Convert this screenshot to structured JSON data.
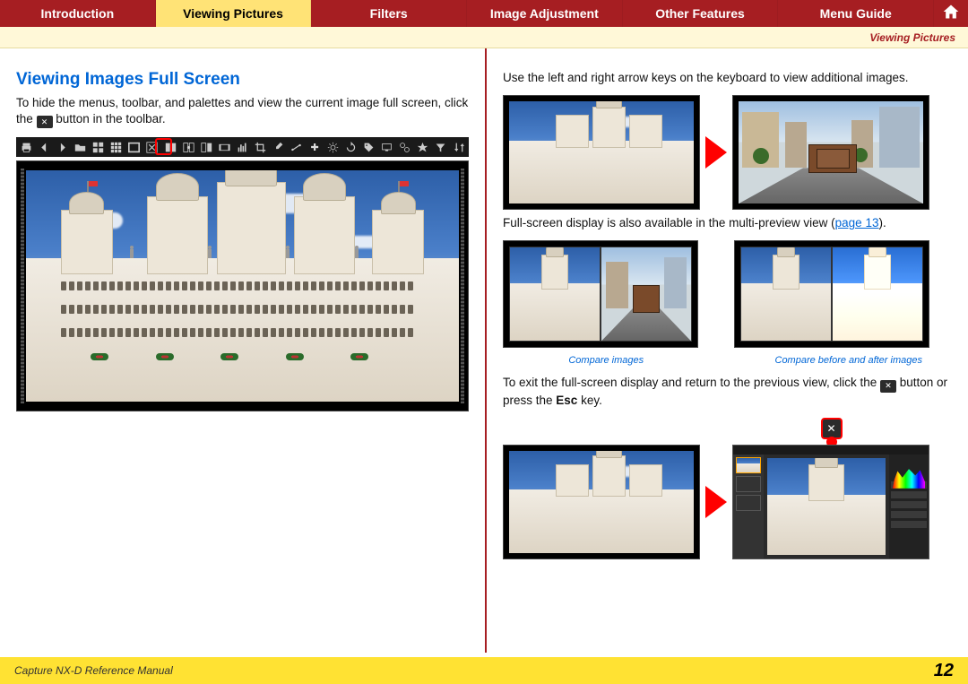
{
  "nav": {
    "tabs": [
      {
        "label": "Introduction"
      },
      {
        "label": "Viewing Pictures"
      },
      {
        "label": "Filters"
      },
      {
        "label": "Image Adjustment"
      },
      {
        "label": "Other Features"
      },
      {
        "label": "Menu Guide"
      }
    ],
    "active_index": 1,
    "home_icon": "home-icon"
  },
  "subbar_label": "Viewing Pictures",
  "left": {
    "title": "Viewing Images Full Screen",
    "para1_a": "To hide the menus, toolbar, and palettes and view the current image full screen, click the ",
    "para1_b": " button in the toolbar.",
    "toolbar_icons": [
      "print-icon",
      "arrow-left-icon",
      "arrow-right-icon",
      "folder-open-icon",
      "thumbnails-icon",
      "grid-icon",
      "single-view-icon",
      "fullscreen-icon",
      "compare2-icon",
      "compare-sync-icon",
      "before-after-icon",
      "filmstrip-icon",
      "histogram-icon",
      "crop-icon",
      "eyedropper-icon",
      "straighten-icon",
      "auto-icon",
      "wb-icon",
      "rotate-icon",
      "tag-icon",
      "monitor-icon",
      "batch-icon",
      "star-icon",
      "filter-icon",
      "sort-icon"
    ],
    "highlighted_tool_index": 7
  },
  "right": {
    "para_arrow": "Use the left and right arrow keys on the keyboard to view additional images.",
    "para_multi_a": "Full-screen display is also available in the multi-preview view (",
    "para_multi_link": "page 13",
    "para_multi_b": ").",
    "caption_compare": "Compare images",
    "caption_before_after": "Compare before and after images",
    "para_exit_a": "To exit the full-screen display and return to the previous view, click the ",
    "para_exit_b": " button or press the ",
    "para_exit_key": "Esc",
    "para_exit_c": " key."
  },
  "footer": {
    "manual_title": "Capture NX-D Reference Manual",
    "page_number": "12"
  },
  "icon_glyphs": {
    "fullscreen_x": "✕"
  }
}
